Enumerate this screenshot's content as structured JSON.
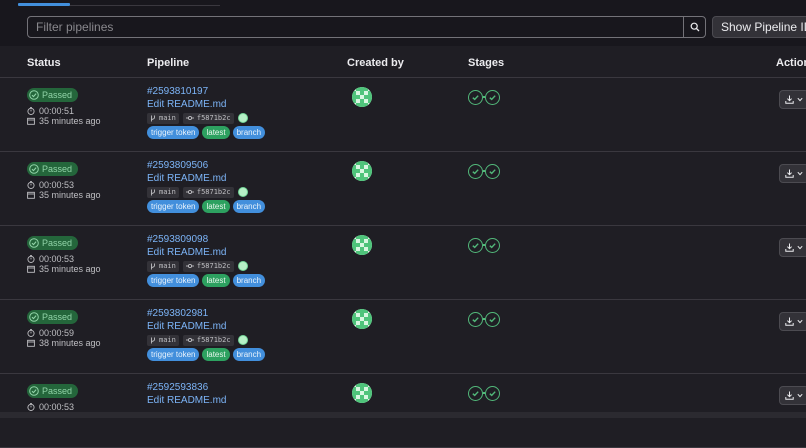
{
  "filter": {
    "placeholder": "Filter pipelines"
  },
  "pipeline_id_toggle": {
    "label": "Show Pipeline ID"
  },
  "columns": {
    "status": "Status",
    "pipeline": "Pipeline",
    "created_by": "Created by",
    "stages": "Stages",
    "actions": "Actions"
  },
  "colors": {
    "passed": "#24663b",
    "link": "#7cb4f7",
    "stage_success": "#52b87a",
    "badge_blue": "#428fdc",
    "badge_green": "#2da160"
  },
  "pipelines": [
    {
      "status": "Passed",
      "duration": "00:00:51",
      "finished": "35 minutes ago",
      "id": "#2593810197",
      "commit_title": "Edit README.md",
      "branch": "main",
      "sha": "f5871b2c",
      "badges": [
        "trigger token",
        "latest",
        "branch"
      ],
      "stages": 2
    },
    {
      "status": "Passed",
      "duration": "00:00:53",
      "finished": "35 minutes ago",
      "id": "#2593809506",
      "commit_title": "Edit README.md",
      "branch": "main",
      "sha": "f5871b2c",
      "badges": [
        "trigger token",
        "latest",
        "branch"
      ],
      "stages": 2
    },
    {
      "status": "Passed",
      "duration": "00:00:53",
      "finished": "35 minutes ago",
      "id": "#2593809098",
      "commit_title": "Edit README.md",
      "branch": "main",
      "sha": "f5871b2c",
      "badges": [
        "trigger token",
        "latest",
        "branch"
      ],
      "stages": 2
    },
    {
      "status": "Passed",
      "duration": "00:00:59",
      "finished": "38 minutes ago",
      "id": "#2593802981",
      "commit_title": "Edit README.md",
      "branch": "main",
      "sha": "f5871b2c",
      "badges": [
        "trigger token",
        "latest",
        "branch"
      ],
      "stages": 2
    },
    {
      "status": "Passed",
      "duration": "00:00:53",
      "finished": "",
      "id": "#2592593836",
      "commit_title": "Edit README.md",
      "branch": "",
      "sha": "",
      "badges": [],
      "stages": 2
    }
  ]
}
